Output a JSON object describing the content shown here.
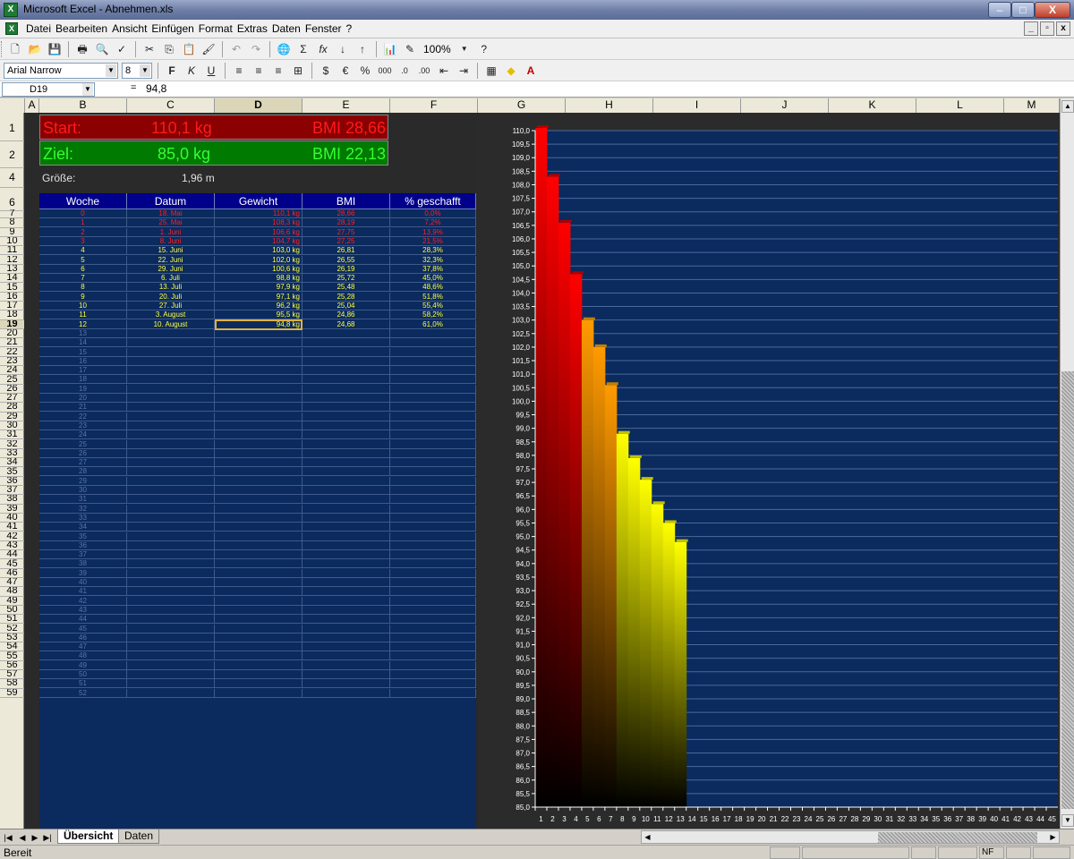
{
  "window": {
    "title": "Microsoft Excel - Abnehmen.xls"
  },
  "menu": {
    "items": [
      "Datei",
      "Bearbeiten",
      "Ansicht",
      "Einfügen",
      "Format",
      "Extras",
      "Daten",
      "Fenster",
      "?"
    ]
  },
  "toolbar": {
    "zoom": "100%",
    "font": "Arial Narrow",
    "font_size": "8"
  },
  "formula": {
    "cell_ref": "D19",
    "equals": "=",
    "value": "94,8"
  },
  "columns": [
    "A",
    "B",
    "C",
    "D",
    "E",
    "F",
    "G",
    "H",
    "I",
    "J",
    "K",
    "L",
    "M"
  ],
  "rows": [
    "1",
    "2",
    "4",
    "6",
    "7",
    "8",
    "9",
    "10",
    "11",
    "12",
    "13",
    "14",
    "15",
    "16",
    "17",
    "18",
    "19",
    "20",
    "21",
    "22",
    "23",
    "24",
    "25",
    "26",
    "27",
    "28",
    "29",
    "30",
    "31",
    "32",
    "33",
    "34",
    "35",
    "36",
    "37",
    "38",
    "39",
    "40",
    "41",
    "42",
    "43",
    "44",
    "45",
    "46",
    "47",
    "48",
    "49",
    "50",
    "51",
    "52",
    "53",
    "54",
    "55",
    "56",
    "57",
    "58",
    "59"
  ],
  "summary": {
    "start_label": "Start:",
    "start_weight": "110,1 kg",
    "start_bmi": "BMI 28,66",
    "goal_label": "Ziel:",
    "goal_weight": "85,0 kg",
    "goal_bmi": "BMI 22,13",
    "height_label": "Größe:",
    "height_value": "1,96 m"
  },
  "table": {
    "headers": [
      "Woche",
      "Datum",
      "Gewicht",
      "BMI",
      "% geschafft"
    ],
    "rows": [
      {
        "week": "0",
        "date": "18. Mai",
        "weight": "110,1 kg",
        "bmi": "28,66",
        "pct": "0,0%",
        "tone": "red"
      },
      {
        "week": "1",
        "date": "25. Mai",
        "weight": "108,3 kg",
        "bmi": "28,19",
        "pct": "7,2%",
        "tone": "red"
      },
      {
        "week": "2",
        "date": "1. Juni",
        "weight": "106,6 kg",
        "bmi": "27,75",
        "pct": "13,9%",
        "tone": "red"
      },
      {
        "week": "3",
        "date": "8. Juni",
        "weight": "104,7 kg",
        "bmi": "27,25",
        "pct": "21,5%",
        "tone": "red"
      },
      {
        "week": "4",
        "date": "15. Juni",
        "weight": "103,0 kg",
        "bmi": "26,81",
        "pct": "28,3%",
        "tone": "yel"
      },
      {
        "week": "5",
        "date": "22. Juni",
        "weight": "102,0 kg",
        "bmi": "26,55",
        "pct": "32,3%",
        "tone": "yel"
      },
      {
        "week": "6",
        "date": "29. Juni",
        "weight": "100,6 kg",
        "bmi": "26,19",
        "pct": "37,8%",
        "tone": "yel"
      },
      {
        "week": "7",
        "date": "6. Juli",
        "weight": "98,8 kg",
        "bmi": "25,72",
        "pct": "45,0%",
        "tone": "yel"
      },
      {
        "week": "8",
        "date": "13. Juli",
        "weight": "97,9 kg",
        "bmi": "25,48",
        "pct": "48,6%",
        "tone": "yel"
      },
      {
        "week": "9",
        "date": "20. Juli",
        "weight": "97,1 kg",
        "bmi": "25,28",
        "pct": "51,8%",
        "tone": "yel"
      },
      {
        "week": "10",
        "date": "27. Juli",
        "weight": "96,2 kg",
        "bmi": "25,04",
        "pct": "55,4%",
        "tone": "yel"
      },
      {
        "week": "11",
        "date": "3. August",
        "weight": "95,5 kg",
        "bmi": "24,86",
        "pct": "58,2%",
        "tone": "yel"
      },
      {
        "week": "12",
        "date": "10. August",
        "weight": "94,8 kg",
        "bmi": "24,68",
        "pct": "61,0%",
        "tone": "yel"
      }
    ],
    "empty_weeks": [
      "13",
      "14",
      "15",
      "16",
      "17",
      "18",
      "19",
      "20",
      "21",
      "22",
      "23",
      "24",
      "25",
      "26",
      "27",
      "28",
      "29",
      "30",
      "31",
      "32",
      "33",
      "34",
      "35",
      "36",
      "37",
      "38",
      "39",
      "40",
      "41",
      "42",
      "43",
      "44",
      "45",
      "46",
      "47",
      "48",
      "49",
      "50",
      "51",
      "52"
    ]
  },
  "chart_data": {
    "type": "bar",
    "title": "",
    "categories": [
      "1",
      "2",
      "3",
      "4",
      "5",
      "6",
      "7",
      "8",
      "9",
      "10",
      "11",
      "12",
      "13",
      "14",
      "15",
      "16",
      "17",
      "18",
      "19",
      "20",
      "21",
      "22",
      "23",
      "24",
      "25",
      "26",
      "27",
      "28",
      "29",
      "30",
      "31",
      "32",
      "33",
      "34",
      "35",
      "36",
      "37",
      "38",
      "39",
      "40",
      "41",
      "42",
      "43",
      "44",
      "45"
    ],
    "values": [
      110.1,
      108.3,
      106.6,
      104.7,
      103.0,
      102.0,
      100.6,
      98.8,
      97.9,
      97.1,
      96.2,
      95.5,
      94.8
    ],
    "ylim": [
      85.0,
      110.0
    ],
    "ytick_step": 0.5,
    "grid": true,
    "colors": {
      "red": "#ff0000",
      "yellow": "#ffff00",
      "background": "#0b2a5e",
      "grid": "#4a6a9a"
    }
  },
  "sheets": {
    "tabs": [
      "Übersicht",
      "Daten"
    ],
    "active": "Übersicht"
  },
  "status": {
    "text": "Bereit",
    "nf": "NF"
  }
}
